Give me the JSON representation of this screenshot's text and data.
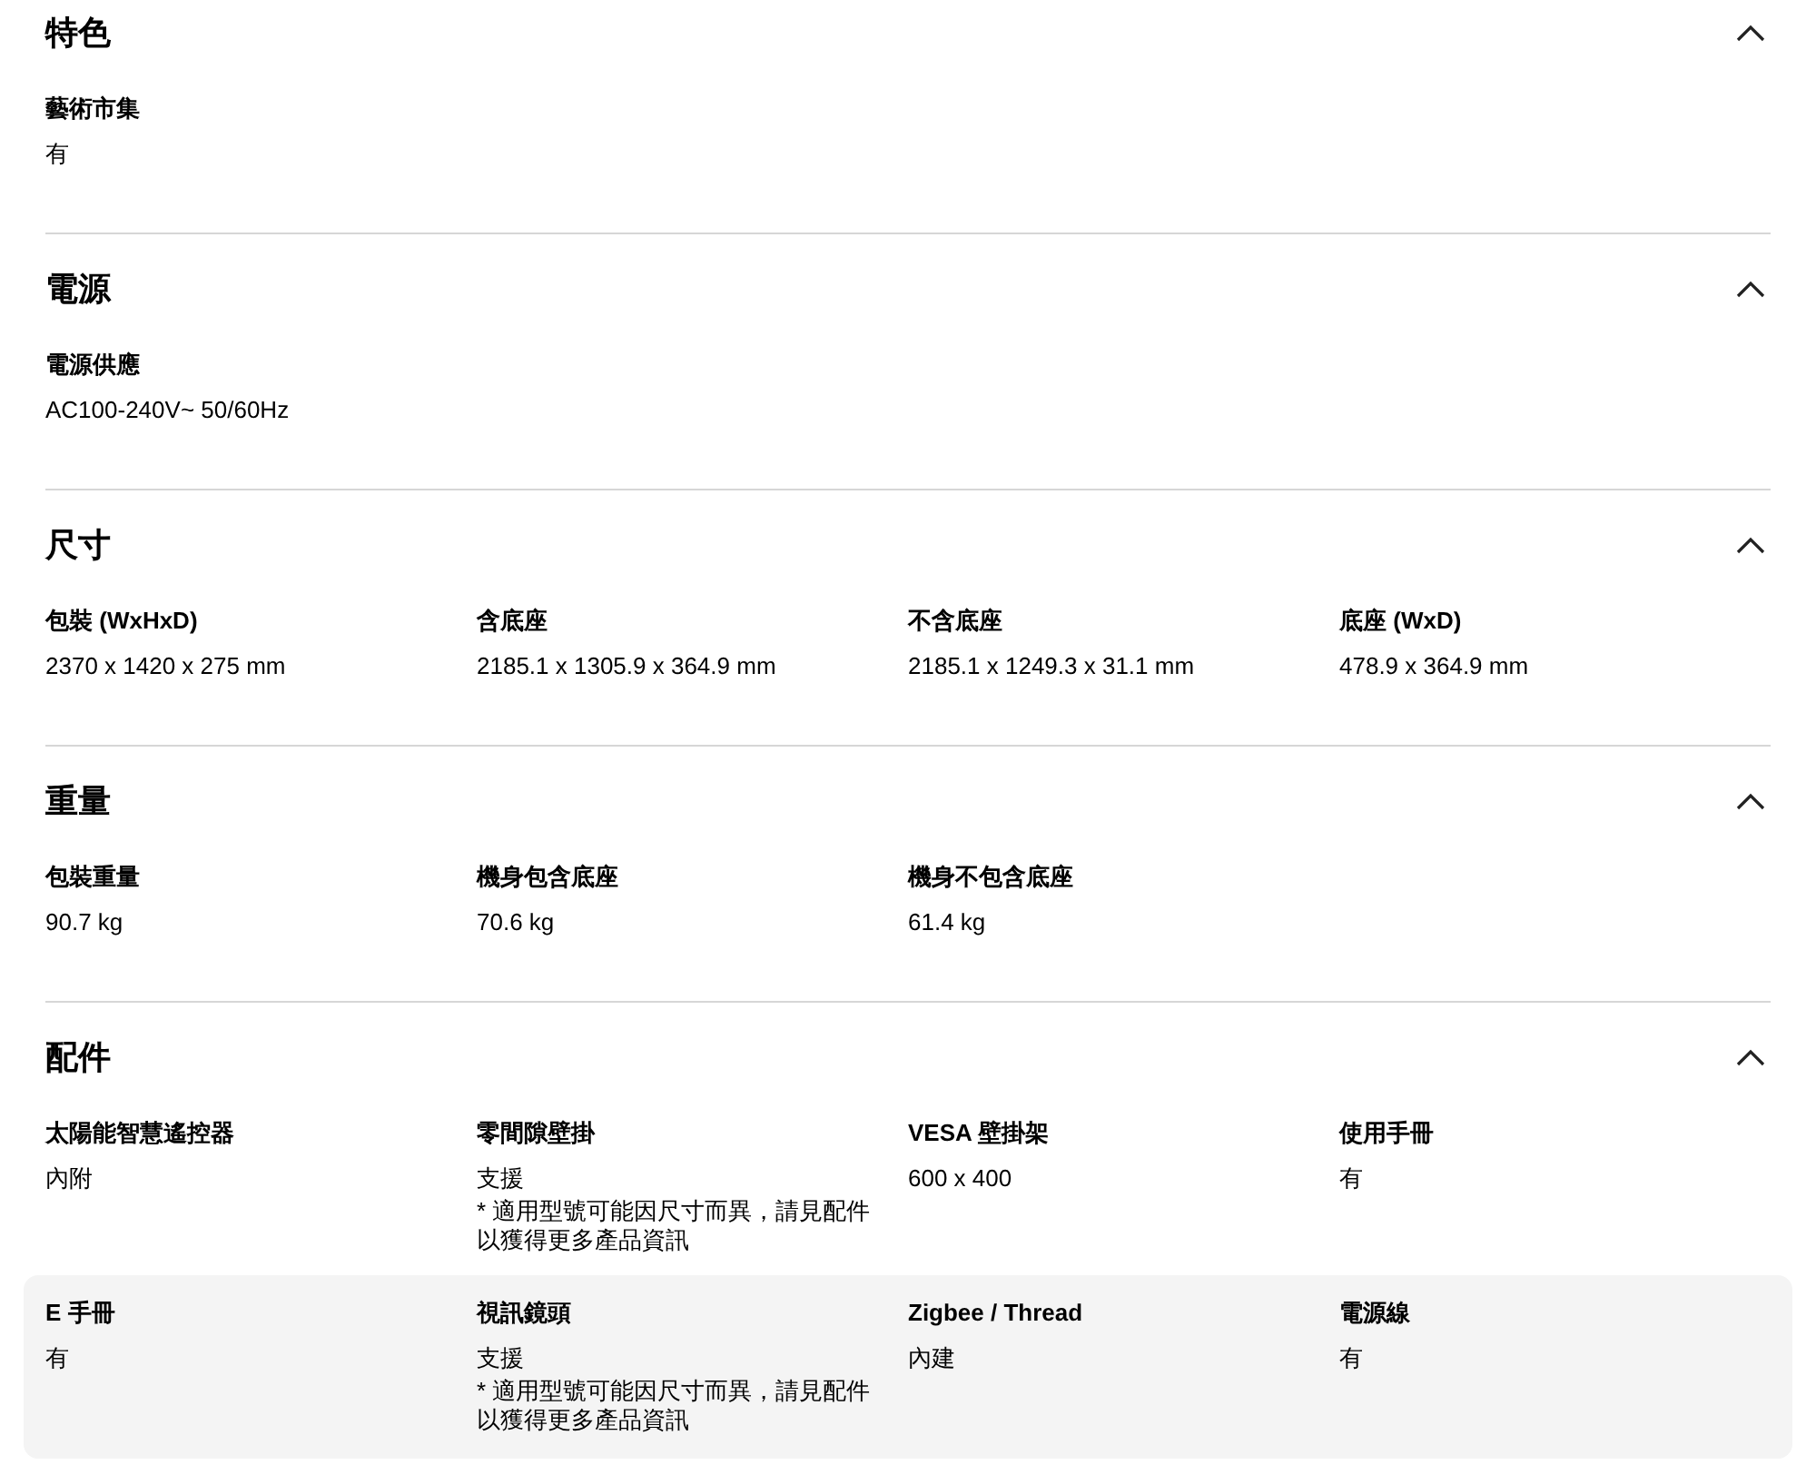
{
  "sections": [
    {
      "title": "特色",
      "expanded": true,
      "rows": [
        {
          "highlighted": false,
          "items": [
            {
              "label": "藝術市集",
              "value": "有"
            }
          ]
        }
      ]
    },
    {
      "title": "電源",
      "expanded": true,
      "rows": [
        {
          "highlighted": false,
          "items": [
            {
              "label": "電源供應",
              "value": "AC100-240V~ 50/60Hz"
            }
          ]
        }
      ]
    },
    {
      "title": "尺寸",
      "expanded": true,
      "rows": [
        {
          "highlighted": false,
          "items": [
            {
              "label": "包裝 (WxHxD)",
              "value": "2370 x 1420 x 275 mm"
            },
            {
              "label": "含底座",
              "value": "2185.1 x 1305.9 x 364.9 mm"
            },
            {
              "label": "不含底座",
              "value": "2185.1 x 1249.3 x 31.1 mm"
            },
            {
              "label": "底座 (WxD)",
              "value": "478.9 x 364.9 mm"
            }
          ]
        }
      ]
    },
    {
      "title": "重量",
      "expanded": true,
      "rows": [
        {
          "highlighted": false,
          "items": [
            {
              "label": "包裝重量",
              "value": "90.7 kg"
            },
            {
              "label": "機身包含底座",
              "value": "70.6 kg"
            },
            {
              "label": "機身不包含底座",
              "value": "61.4 kg"
            }
          ]
        }
      ]
    },
    {
      "title": "配件",
      "expanded": true,
      "rows": [
        {
          "highlighted": false,
          "items": [
            {
              "label": "太陽能智慧遙控器",
              "value": "內附"
            },
            {
              "label": "零間隙壁掛",
              "value": "支援",
              "note": "* 適用型號可能因尺寸而異，請見配件以獲得更多產品資訊"
            },
            {
              "label": "VESA 壁掛架",
              "value": "600 x 400"
            },
            {
              "label": "使用手冊",
              "value": "有"
            }
          ]
        },
        {
          "highlighted": true,
          "items": [
            {
              "label": "E 手冊",
              "value": "有"
            },
            {
              "label": "視訊鏡頭",
              "value": "支援",
              "note": "* 適用型號可能因尺寸而異，請見配件以獲得更多產品資訊"
            },
            {
              "label": "Zigbee / Thread",
              "value": "內建"
            },
            {
              "label": "電源線",
              "value": "有"
            }
          ]
        }
      ]
    }
  ]
}
